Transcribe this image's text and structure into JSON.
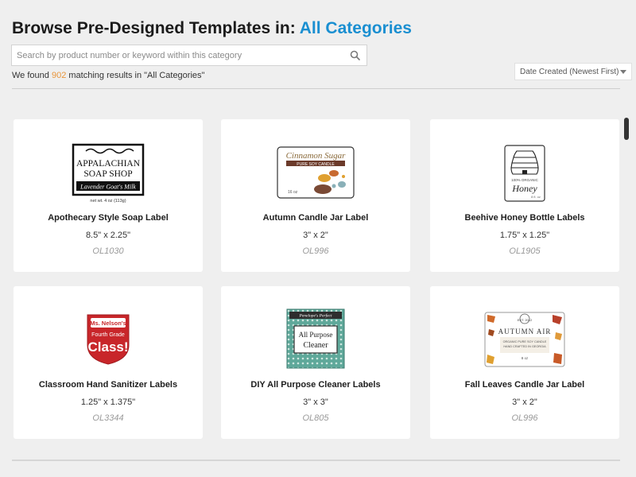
{
  "header": {
    "title_prefix": "Browse Pre-Designed Templates in:",
    "title_category": "All Categories"
  },
  "search": {
    "placeholder": "Search by product number or keyword within this category",
    "value": "",
    "icon": "search-icon"
  },
  "results": {
    "prefix": "We found",
    "count": "902",
    "suffix": "matching results in \"All Categories\""
  },
  "sort": {
    "selected": "Date Created (Newest First)"
  },
  "products": [
    {
      "name": "Apothecary Style Soap Label",
      "size": "8.5\" x 2.25\"",
      "sku": "OL1030",
      "thumb": {
        "line1": "APPALACHIAN",
        "line2": "SOAP SHOP",
        "band": "Lavender Goat's Milk",
        "caption": "net wt. 4 oz (113g)"
      }
    },
    {
      "name": "Autumn Candle Jar Label",
      "size": "3\" x 2\"",
      "sku": "OL996",
      "thumb": {
        "line1": "Cinnamon Sugar",
        "band": "PURE SOY CANDLE",
        "caption": "16 oz"
      }
    },
    {
      "name": "Beehive Honey Bottle Labels",
      "size": "1.75\" x 1.25\"",
      "sku": "OL1905",
      "thumb": {
        "line1": "100% ORGANIC",
        "line2": "Honey",
        "caption": "8 fl. oz"
      }
    },
    {
      "name": "Classroom Hand Sanitizer Labels",
      "size": "1.25\" x 1.375\"",
      "sku": "OL3344",
      "thumb": {
        "line1": "Ms. Nelson's",
        "line2": "Fourth Grade",
        "line3": "Class!"
      }
    },
    {
      "name": "DIY All Purpose Cleaner Labels",
      "size": "3\" x 3\"",
      "sku": "OL805",
      "thumb": {
        "line1": "Penelope's Perfect",
        "line2": "All Purpose",
        "line3": "Cleaner"
      }
    },
    {
      "name": "Fall Leaves Candle Jar Label",
      "size": "3\" x 2\"",
      "sku": "OL996",
      "thumb": {
        "line1": "EST. 2012",
        "line2": "AUTUMN AIR",
        "line3": "ORGANIC PURE SOY CANDLE",
        "line4": "HAND CRAFTED IN GEORGIA",
        "caption": "8 oz"
      }
    }
  ],
  "colors": {
    "accent": "#1a8fd1",
    "count": "#e8953a",
    "background": "#efefef"
  }
}
